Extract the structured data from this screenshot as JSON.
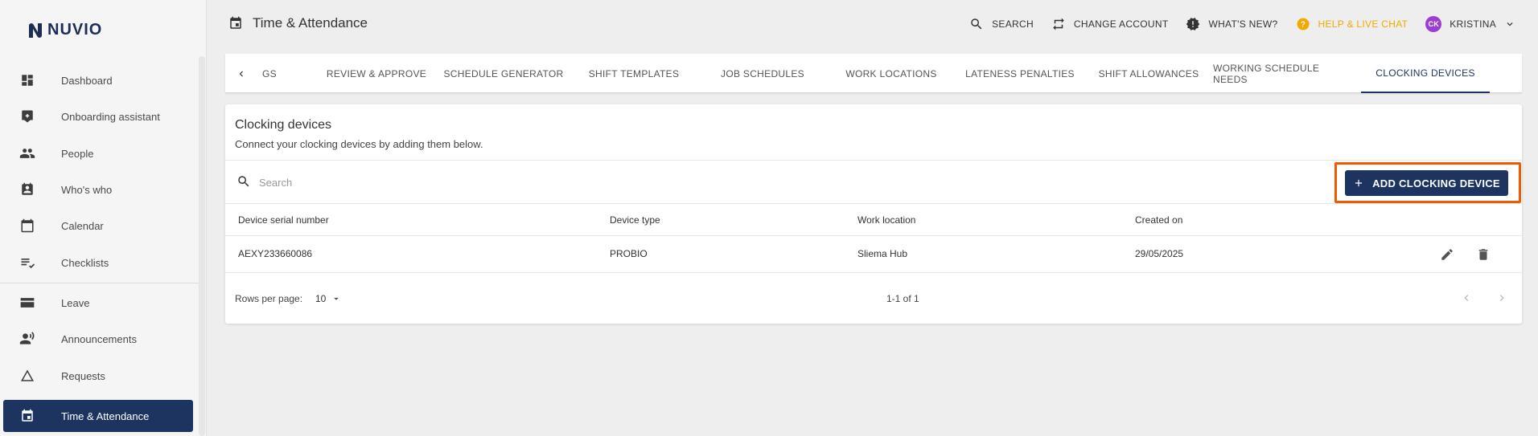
{
  "brand": {
    "name": "NUVIO"
  },
  "sidebar": {
    "items": [
      {
        "label": "Dashboard",
        "icon": "dashboard-icon"
      },
      {
        "label": "Onboarding assistant",
        "icon": "onboarding-icon"
      },
      {
        "label": "People",
        "icon": "people-icon"
      },
      {
        "label": "Who's who",
        "icon": "contact-badge-icon"
      },
      {
        "label": "Calendar",
        "icon": "calendar-icon"
      },
      {
        "label": "Checklists",
        "icon": "checklist-icon"
      },
      {
        "label": "Leave",
        "icon": "leave-icon"
      },
      {
        "label": "Announcements",
        "icon": "announcements-icon"
      },
      {
        "label": "Requests",
        "icon": "requests-icon"
      },
      {
        "label": "Time & Attendance",
        "icon": "time-attendance-icon",
        "active": true
      }
    ]
  },
  "header": {
    "title": "Time & Attendance",
    "actions": {
      "search": "SEARCH",
      "change_account": "CHANGE ACCOUNT",
      "whats_new": "WHAT'S NEW?",
      "help": "HELP & LIVE CHAT",
      "user_initials": "CK",
      "user_name": "KRISTINA"
    }
  },
  "tabs": [
    {
      "label": "GS"
    },
    {
      "label": "REVIEW & APPROVE"
    },
    {
      "label": "SCHEDULE GENERATOR"
    },
    {
      "label": "SHIFT TEMPLATES"
    },
    {
      "label": "JOB SCHEDULES"
    },
    {
      "label": "WORK LOCATIONS"
    },
    {
      "label": "LATENESS PENALTIES"
    },
    {
      "label": "SHIFT ALLOWANCES"
    },
    {
      "label": "WORKING SCHEDULE NEEDS"
    },
    {
      "label": "CLOCKING DEVICES",
      "active": true
    }
  ],
  "main": {
    "title": "Clocking devices",
    "subtitle": "Connect your clocking devices by adding them below.",
    "search": {
      "placeholder": "Search",
      "value": ""
    },
    "add_button": "ADD CLOCKING DEVICE",
    "table": {
      "columns": [
        "Device serial number",
        "Device type",
        "Work location",
        "Created on"
      ],
      "rows": [
        {
          "serial": "AEXY233660086",
          "type": "PROBIO",
          "location": "Sliema Hub",
          "created": "29/05/2025"
        }
      ]
    },
    "pagination": {
      "rows_per_page_label": "Rows per page:",
      "rows_per_page": "10",
      "range": "1-1 of 1"
    }
  },
  "colors": {
    "primary": "#1d3461",
    "help": "#f2a900",
    "highlight": "#f05a00",
    "avatar": "#9c3fd1"
  }
}
